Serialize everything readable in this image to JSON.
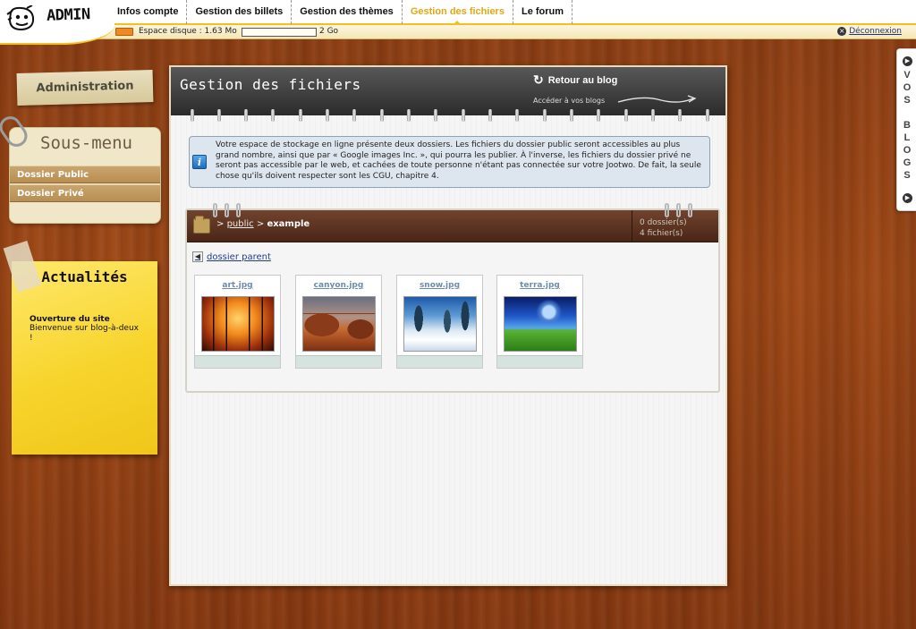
{
  "app": {
    "logo_text": "ADMIN"
  },
  "nav": {
    "items": [
      {
        "label": "Infos compte"
      },
      {
        "label": "Gestion des billets"
      },
      {
        "label": "Gestion des thèmes"
      },
      {
        "label": "Gestion des fichiers"
      },
      {
        "label": "Le forum"
      }
    ],
    "active_index": 3
  },
  "disk": {
    "label": "Espace disque : 1.63 Mo",
    "max_label": "2 Go",
    "usage_fraction": 0.0008
  },
  "logout": {
    "label": "Déconnexion",
    "icon": "close-circle-icon"
  },
  "sidebar": {
    "admin_label": "Administration",
    "submenu_title": "Sous-menu",
    "submenu_items": [
      {
        "label": "Dossier Public"
      },
      {
        "label": "Dossier Privé"
      }
    ],
    "news": {
      "title": "Actualités",
      "item_title": "Ouverture du site",
      "item_body": "Bienvenue sur blog-à-deux !"
    }
  },
  "panel": {
    "title": "Gestion des fichiers",
    "back_label": "Retour au blog",
    "back_icon": "refresh-arrow-icon",
    "access_label": "Accéder à vos blogs",
    "info_text": "Votre espace de stockage en ligne présente deux dossiers. Les fichiers du dossier public seront accessibles au plus grand nombre, ainsi que par « Google images Inc. », qui pourra les publier. À l'inverse, les fichiers du dossier privé ne seront pas accessible par le web, et cachées de toute personne n'étant pas connectée sur votre Jootwo. De fait, la seule chose qu'ils doivent respecter sont les CGU, chapitre 4."
  },
  "browser": {
    "path_sep": ">",
    "path_root": "public",
    "path_current": "example",
    "folder_count": "0 dossier(s)",
    "file_count": "4 fichier(s)",
    "parent_label": "dossier parent",
    "files": [
      {
        "name": "art.jpg"
      },
      {
        "name": "canyon.jpg"
      },
      {
        "name": "snow.jpg"
      },
      {
        "name": "terra.jpg"
      }
    ]
  },
  "right_tab": {
    "label": "VOS BLOGS"
  },
  "colors": {
    "accent": "#f3c11d",
    "active_nav": "#e0a815",
    "wood": "#9a4616",
    "header_dark": "#2b2b2b",
    "browser_bar": "#4a2616",
    "info_bg": "#dde6ee",
    "link": "#1f3e8f"
  }
}
